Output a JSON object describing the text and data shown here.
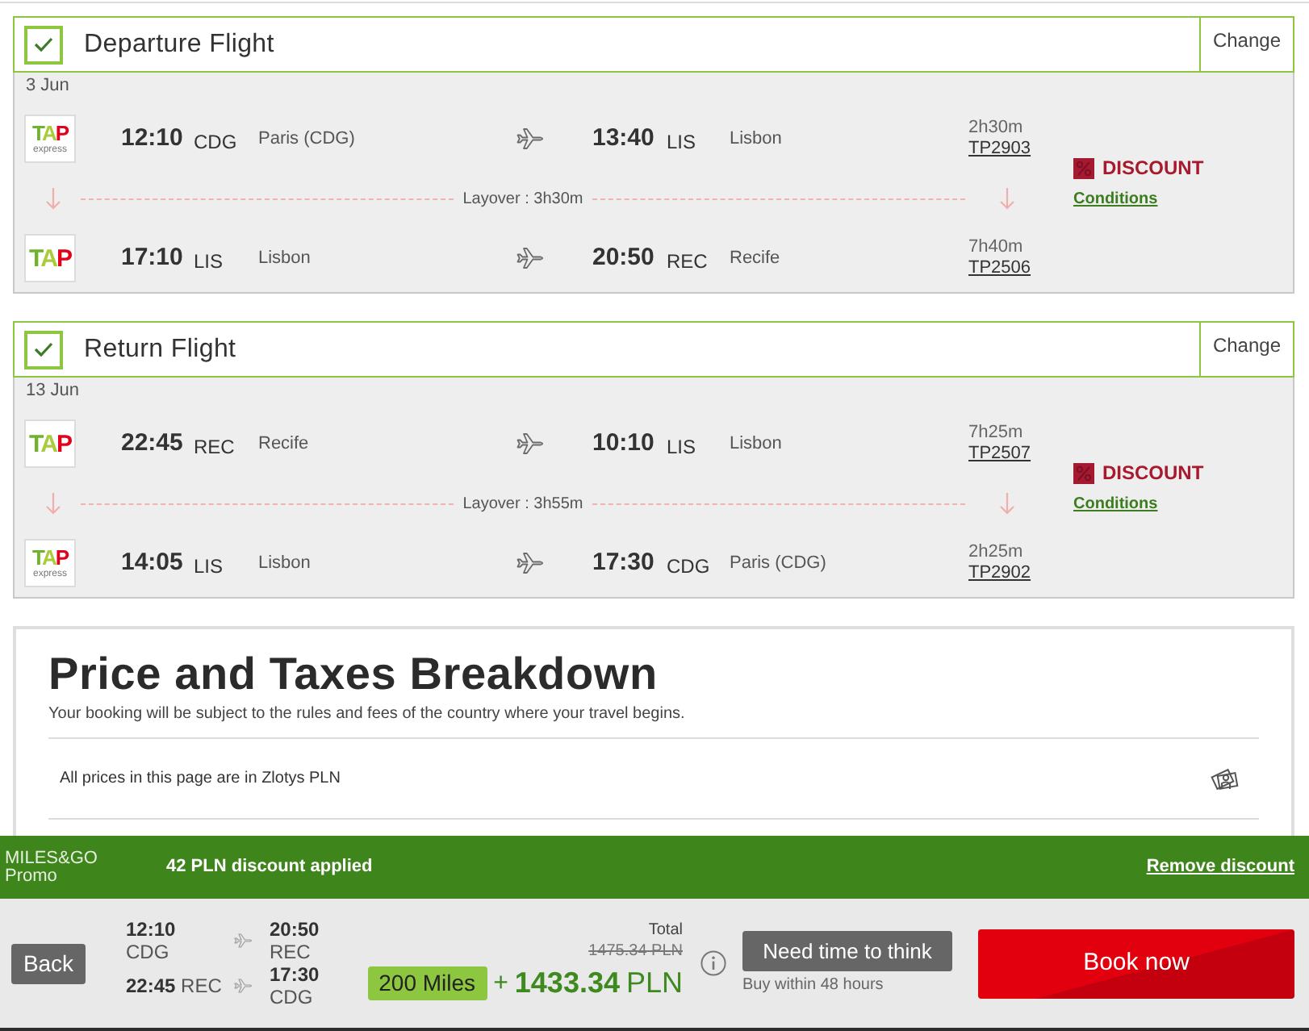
{
  "flights": [
    {
      "title": "Departure Flight",
      "checked": true,
      "change": "Change",
      "date": "3 Jun",
      "segments": [
        {
          "logo": {
            "text": "TAP",
            "subtext": "express"
          },
          "depart": {
            "time": "12:10",
            "code": "CDG",
            "city": "Paris (CDG)"
          },
          "arrive": {
            "time": "13:40",
            "code": "LIS",
            "city": "Lisbon"
          },
          "duration": "2h30m",
          "flight_number": "TP2903"
        },
        {
          "logo": {
            "text": "TAP"
          },
          "depart": {
            "time": "17:10",
            "code": "LIS",
            "city": "Lisbon"
          },
          "arrive": {
            "time": "20:50",
            "code": "REC",
            "city": "Recife"
          },
          "duration": "7h40m",
          "flight_number": "TP2506"
        }
      ],
      "layover": "Layover : 3h30m",
      "fare": {
        "label": "DISCOUNT",
        "conditions": "Conditions"
      }
    },
    {
      "title": "Return Flight",
      "checked": true,
      "change": "Change",
      "date": "13 Jun",
      "segments": [
        {
          "logo": {
            "text": "TAP"
          },
          "depart": {
            "time": "22:45",
            "code": "REC",
            "city": "Recife"
          },
          "arrive": {
            "time": "10:10",
            "code": "LIS",
            "city": "Lisbon"
          },
          "duration": "7h25m",
          "flight_number": "TP2507"
        },
        {
          "logo": {
            "text": "TAP",
            "subtext": "express"
          },
          "depart": {
            "time": "14:05",
            "code": "LIS",
            "city": "Lisbon"
          },
          "arrive": {
            "time": "17:30",
            "code": "CDG",
            "city": "Paris (CDG)"
          },
          "duration": "2h25m",
          "flight_number": "TP2902"
        }
      ],
      "layover": "Layover : 3h55m",
      "fare": {
        "label": "DISCOUNT",
        "conditions": "Conditions"
      }
    }
  ],
  "price_breakdown": {
    "title": "Price and Taxes Breakdown",
    "subtitle": "Your booking will be subject to the rules and fees of the country where your travel begins.",
    "currency_note": "All prices in this page are in Zlotys PLN"
  },
  "promo_bar": {
    "brand": "MILES&GO",
    "brand_sub": "Promo",
    "message": "42 PLN discount applied",
    "remove": "Remove discount"
  },
  "summary_bar": {
    "back": "Back",
    "legs": [
      {
        "depart": {
          "time": "12:10",
          "code": "CDG"
        },
        "arrive": {
          "time": "20:50",
          "code": "REC"
        }
      },
      {
        "depart": {
          "time": "22:45",
          "code": "REC"
        },
        "arrive": {
          "time": "17:30",
          "code": "CDG"
        }
      }
    ],
    "total_label": "Total",
    "old_price": "1475.34 PLN",
    "miles": "200 Miles",
    "plus": "+",
    "price": "1433.34",
    "currency": "PLN",
    "think_button": "Need time to think",
    "think_note": "Buy within 48 hours",
    "book": "Book now"
  }
}
